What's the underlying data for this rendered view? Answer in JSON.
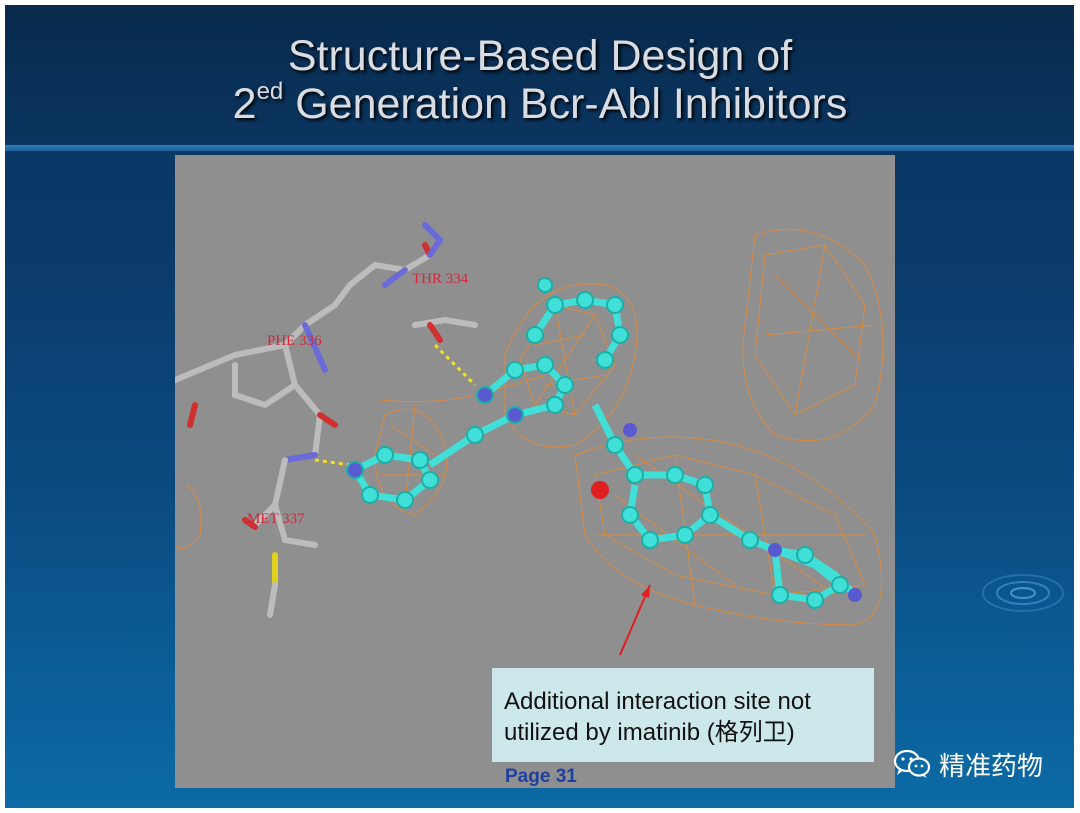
{
  "slide": {
    "title_line1": "Structure-Based Design of",
    "title_line2_prefix": "2",
    "title_line2_superscript": "ed",
    "title_line2_rest": " Generation Bcr-Abl Inhibitors"
  },
  "figure": {
    "residue_labels": [
      "THR 334",
      "PHE 336",
      "MET 337"
    ],
    "callout_line1": "Additional interaction site not",
    "callout_line2": "utilized by imatinib (格列卫)",
    "page_label": "Page 31"
  },
  "watermark": {
    "icon": "wechat-icon",
    "text": "精准药物"
  },
  "colors": {
    "slide_background": "#0b3a69",
    "figure_background": "#8f8f8f",
    "ligand": "#40e0d8",
    "surface_mesh": "#e08a38",
    "residue_label": "#d2283a",
    "callout_background": "#cde8ea",
    "page_label": "#1f3fa0"
  }
}
